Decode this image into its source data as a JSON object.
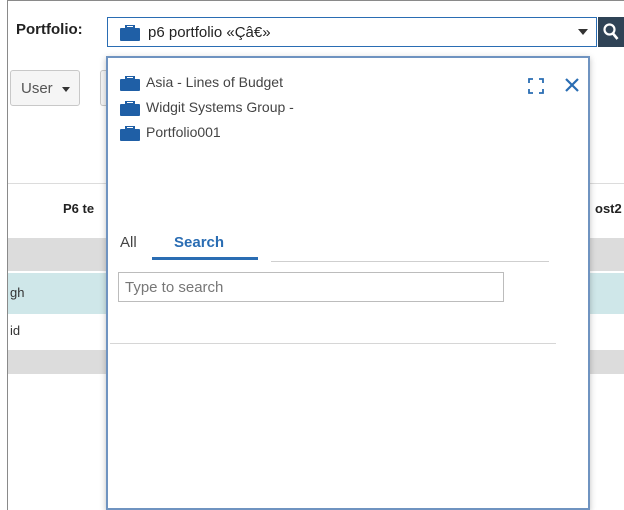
{
  "header": {
    "portfolio_label": "Portfolio:",
    "selected_portfolio": "p6 portfolio «Çâ€»"
  },
  "toolbar": {
    "user_label": "User"
  },
  "table": {
    "columns": [
      "P6 te",
      "ost2"
    ],
    "rows": [
      "gh",
      "id"
    ]
  },
  "dropdown": {
    "items": [
      {
        "label": "Asia - Lines of Budget",
        "icon": "briefcase-icon"
      },
      {
        "label": "Widgit Systems Group -",
        "icon": "briefcase-icon"
      },
      {
        "label": "Portfolio001",
        "icon": "briefcase-icon"
      }
    ],
    "tabs": [
      "All",
      "Search"
    ],
    "active_tab": "Search",
    "search_placeholder": "Type to search"
  },
  "colors": {
    "accent": "#2a6db3",
    "search_button_bg": "#2f4356",
    "selected_row": "#cfe7e9",
    "band": "#dcdcdc",
    "briefcase": "#1f5fa6"
  }
}
